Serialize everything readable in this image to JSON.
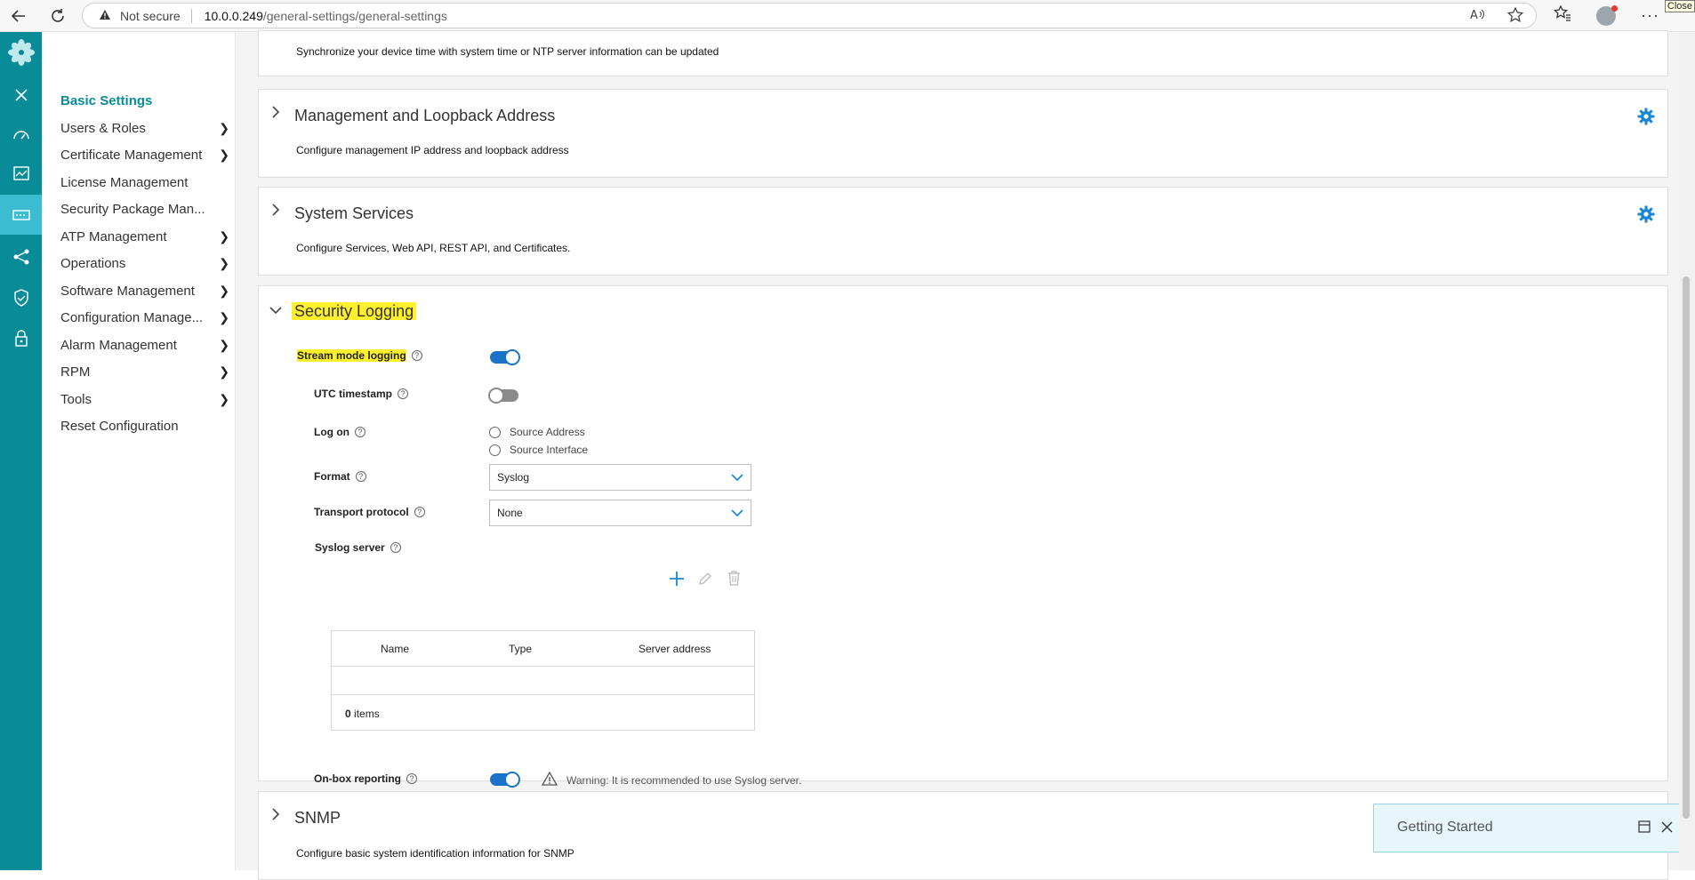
{
  "browser": {
    "security_label": "Not secure",
    "url_host": "10.0.0.249",
    "url_path": "/general-settings/general-settings",
    "tooltip": "Close"
  },
  "sidebar": {
    "items": [
      {
        "label": "Basic Settings",
        "chevron": false,
        "active": true
      },
      {
        "label": "Users & Roles",
        "chevron": true
      },
      {
        "label": "Certificate Management",
        "chevron": true
      },
      {
        "label": "License Management",
        "chevron": false
      },
      {
        "label": "Security Package Man...",
        "chevron": false
      },
      {
        "label": "ATP Management",
        "chevron": true
      },
      {
        "label": "Operations",
        "chevron": true
      },
      {
        "label": "Software Management",
        "chevron": true
      },
      {
        "label": "Configuration Manage...",
        "chevron": true
      },
      {
        "label": "Alarm Management",
        "chevron": true
      },
      {
        "label": "RPM",
        "chevron": true
      },
      {
        "label": "Tools",
        "chevron": true
      },
      {
        "label": "Reset Configuration",
        "chevron": false
      }
    ]
  },
  "panels": {
    "time": {
      "desc": "Synchronize your device time with system time or NTP server information can be updated"
    },
    "mgmt": {
      "title": "Management and Loopback Address",
      "desc": "Configure management IP address and loopback address"
    },
    "services": {
      "title": "System Services",
      "desc": "Configure Services, Web API, REST API, and Certificates."
    },
    "logging": {
      "title": "Security Logging",
      "stream_mode_label": "Stream mode logging",
      "stream_mode_on": true,
      "utc_label": "UTC timestamp",
      "utc_on": false,
      "logon_label": "Log on",
      "logon_options": [
        "Source Address",
        "Source Interface"
      ],
      "format_label": "Format",
      "format_value": "Syslog",
      "transport_label": "Transport protocol",
      "transport_value": "None",
      "syslog_label": "Syslog server",
      "table_columns": [
        "Name",
        "Type",
        "Server address"
      ],
      "items_count": "0",
      "items_suffix": " items",
      "onbox_label": "On-box reporting",
      "onbox_on": true,
      "onbox_warning": "Warning: It is recommended to use Syslog server."
    },
    "snmp": {
      "title": "SNMP",
      "desc": "Configure basic system identification information for SNMP"
    }
  },
  "toast": {
    "title": "Getting Started"
  },
  "colors": {
    "rail": "#0a8c98",
    "rail_active": "#3bbcd0",
    "accent": "#1a73c8",
    "highlight": "#fff02e"
  }
}
